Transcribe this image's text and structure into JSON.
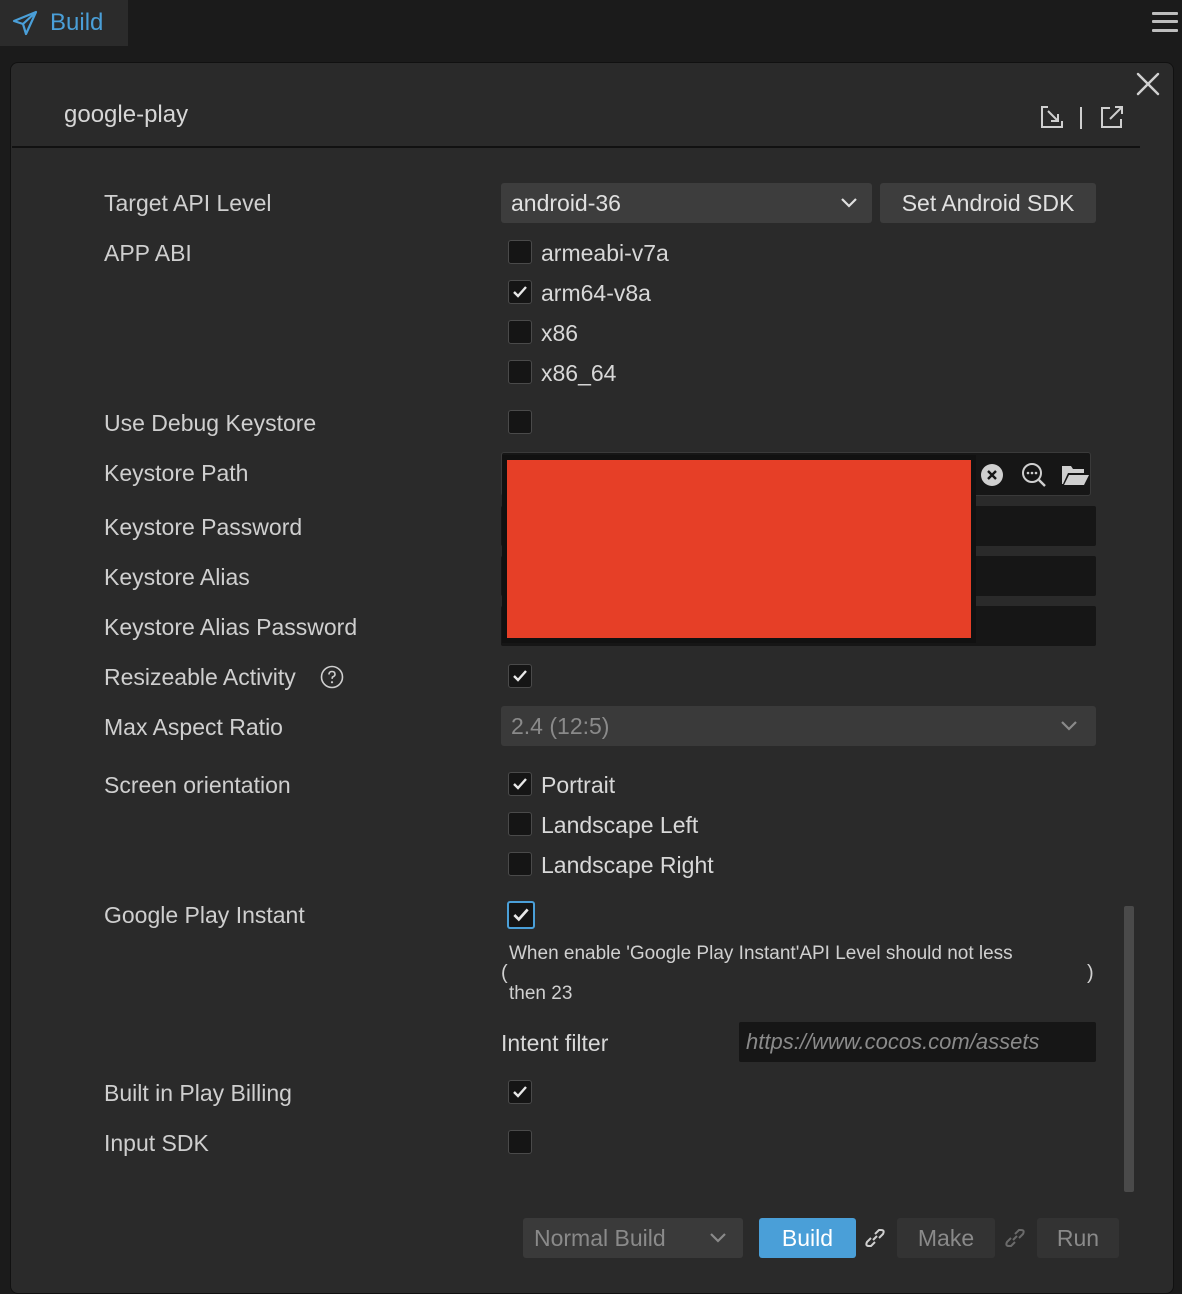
{
  "tab": {
    "label": "Build",
    "icon": "paper-plane-icon"
  },
  "panel": {
    "title": "google-play"
  },
  "target_api": {
    "label": "Target API Level",
    "value": "android-36",
    "sdk_button": "Set Android SDK"
  },
  "app_abi": {
    "label": "APP ABI",
    "options": [
      {
        "label": "armeabi-v7a",
        "checked": false
      },
      {
        "label": "arm64-v8a",
        "checked": true
      },
      {
        "label": "x86",
        "checked": false
      },
      {
        "label": "x86_64",
        "checked": false
      }
    ]
  },
  "debug_keystore": {
    "label": "Use Debug Keystore",
    "checked": false
  },
  "keystore": {
    "path_label": "Keystore Path",
    "password_label": "Keystore Password",
    "alias_label": "Keystore Alias",
    "alias_password_label": "Keystore Alias Password",
    "redaction_color": "#e63f27"
  },
  "resizeable": {
    "label": "Resizeable Activity",
    "checked": true
  },
  "max_aspect": {
    "label": "Max Aspect Ratio",
    "value": "2.4 (12:5)"
  },
  "orientation": {
    "label": "Screen orientation",
    "options": [
      {
        "label": "Portrait",
        "checked": true
      },
      {
        "label": "Landscape Left",
        "checked": false
      },
      {
        "label": "Landscape Right",
        "checked": false
      }
    ]
  },
  "play_instant": {
    "label": "Google Play Instant",
    "checked": true,
    "note_line1": "When enable 'Google Play Instant'API Level should not less",
    "note_line2": "then 23",
    "paren_open": "(",
    "paren_close": ")",
    "intent_label": "Intent filter",
    "intent_placeholder": "https://www.cocos.com/assets"
  },
  "play_billing": {
    "label": "Built in Play Billing",
    "checked": true
  },
  "input_sdk": {
    "label": "Input SDK",
    "checked": false
  },
  "footer": {
    "build_type": "Normal Build",
    "build": "Build",
    "make": "Make",
    "run": "Run"
  },
  "colors": {
    "accent": "#4a9fd8",
    "panel": "#2a2a2a"
  }
}
